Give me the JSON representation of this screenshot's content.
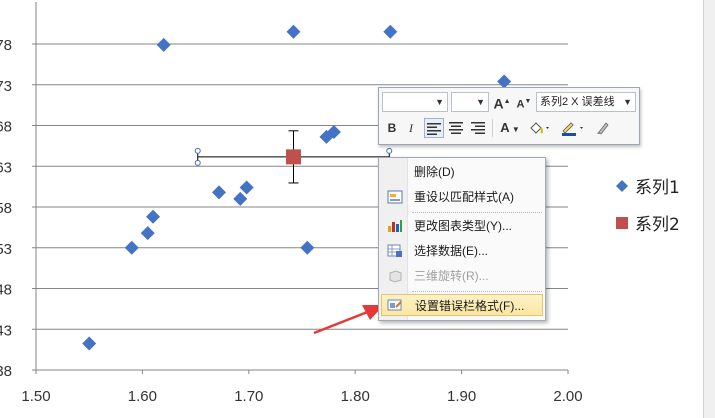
{
  "chart_data": {
    "type": "scatter",
    "title": "",
    "xlabel": "",
    "ylabel": "",
    "xlim": [
      1.5,
      2.0
    ],
    "ylim": [
      0.38,
      0.805
    ],
    "x_ticks": [
      "1.50",
      "1.60",
      "1.70",
      "1.80",
      "1.90",
      "2.00"
    ],
    "y_ticks": [
      "38",
      "43",
      "48",
      "53",
      "58",
      "63",
      "68",
      "73",
      "78"
    ],
    "y_tick_values": [
      0.38,
      0.43,
      0.48,
      0.53,
      0.58,
      0.63,
      0.68,
      0.73,
      0.78
    ],
    "grid": "horizontal",
    "legend_position": "right",
    "series": [
      {
        "name": "系列1",
        "marker": "diamond",
        "color": "#4472c4",
        "points": [
          [
            1.55,
            0.4125
          ],
          [
            1.59,
            0.53
          ],
          [
            1.605,
            0.548
          ],
          [
            1.61,
            0.568
          ],
          [
            1.62,
            0.779
          ],
          [
            1.672,
            0.598
          ],
          [
            1.692,
            0.59
          ],
          [
            1.698,
            0.604
          ],
          [
            1.742,
            0.795
          ],
          [
            1.755,
            0.53
          ],
          [
            1.773,
            0.666
          ],
          [
            1.78,
            0.672
          ],
          [
            1.833,
            0.795
          ],
          [
            1.94,
            0.734
          ]
        ]
      },
      {
        "name": "系列2",
        "marker": "square",
        "color": "#c0504d",
        "points": [
          [
            1.742,
            0.6415
          ]
        ],
        "y_error": 0.032,
        "x_error": 0.09
      }
    ]
  },
  "mini_toolbar": {
    "font_value": "",
    "size_value": "",
    "grow_font": "A",
    "shrink_font": "A",
    "element_selector": "系列2 X 误差线",
    "bold": "B",
    "italic": "I",
    "font_color_letter": "A"
  },
  "context_menu": {
    "items": [
      {
        "label": "删除(D)",
        "enabled": true,
        "icon": ""
      },
      {
        "label": "重设以匹配样式(A)",
        "enabled": true,
        "icon": "reset-style-icon"
      },
      {
        "label": "更改图表类型(Y)...",
        "enabled": true,
        "icon": "change-chart-type-icon"
      },
      {
        "label": "选择数据(E)...",
        "enabled": true,
        "icon": "select-data-icon"
      },
      {
        "label": "三维旋转(R)...",
        "enabled": false,
        "icon": "3d-rotation-icon"
      },
      {
        "label": "设置错误栏格式(F)...",
        "enabled": true,
        "icon": "format-error-bars-icon",
        "highlighted": true
      }
    ]
  },
  "annotation": {
    "arrow_color": "#e53935"
  }
}
